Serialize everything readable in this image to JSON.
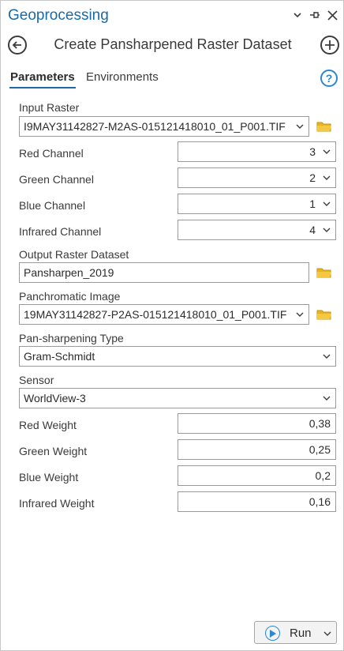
{
  "window": {
    "title": "Geoprocessing",
    "controls": [
      "chevron-down-icon",
      "pin-icon",
      "close-icon"
    ]
  },
  "header": {
    "tool_title": "Create Pansharpened Raster Dataset",
    "back_icon": "back-arrow-icon",
    "add_icon": "add-icon"
  },
  "tabs": {
    "parameters": "Parameters",
    "environments": "Environments",
    "active": "Parameters",
    "help_icon": "?"
  },
  "params": {
    "input_raster": {
      "label": "Input Raster",
      "value": "I9MAY31142827-M2AS-015121418010_01_P001.TIF"
    },
    "red_channel": {
      "label": "Red Channel",
      "value": "3"
    },
    "green_channel": {
      "label": "Green Channel",
      "value": "2"
    },
    "blue_channel": {
      "label": "Blue Channel",
      "value": "1"
    },
    "infrared_channel": {
      "label": "Infrared Channel",
      "value": "4"
    },
    "output_raster": {
      "label": "Output Raster Dataset",
      "value": "Pansharpen_2019"
    },
    "panchromatic_image": {
      "label": "Panchromatic Image",
      "value": "19MAY31142827-P2AS-015121418010_01_P001.TIF"
    },
    "pansharpening_type": {
      "label": "Pan-sharpening Type",
      "value": "Gram-Schmidt"
    },
    "sensor": {
      "label": "Sensor",
      "value": "WorldView-3"
    },
    "red_weight": {
      "label": "Red Weight",
      "value": "0,38"
    },
    "green_weight": {
      "label": "Green Weight",
      "value": "0,25"
    },
    "blue_weight": {
      "label": "Blue Weight",
      "value": "0,2"
    },
    "infrared_weight": {
      "label": "Infrared Weight",
      "value": "0,16"
    }
  },
  "run_button": {
    "label": "Run"
  },
  "colors": {
    "accent": "#1a6aa8",
    "help": "#2b86d4",
    "folder": "#e8b322"
  }
}
